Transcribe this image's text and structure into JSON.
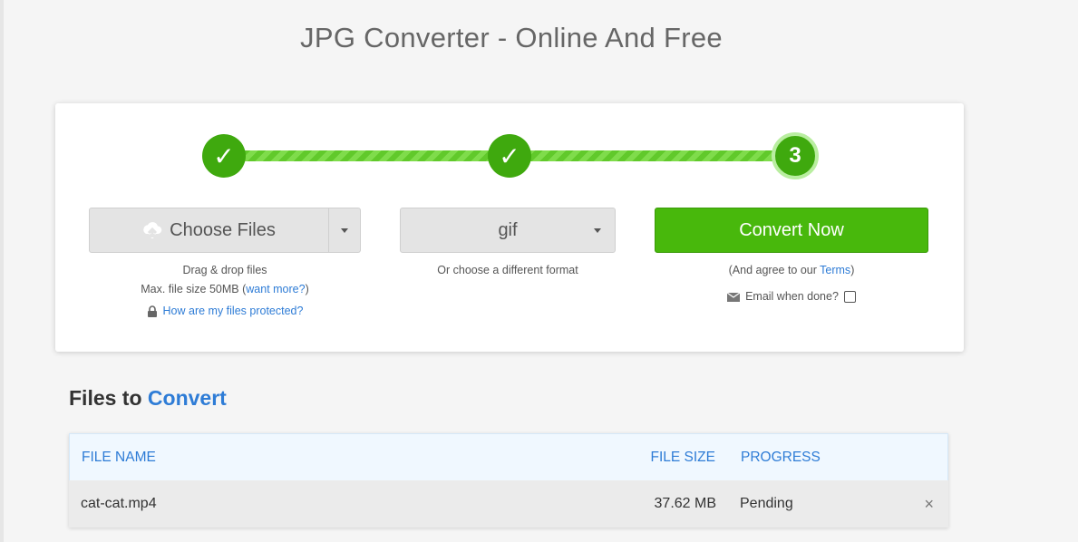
{
  "title": "JPG Converter - Online And Free",
  "steps": {
    "step1": "✓",
    "step2": "✓",
    "step3": "3"
  },
  "choose": {
    "label": "Choose Files",
    "drag": "Drag & drop files",
    "max_prefix": "Max. file size 50MB (",
    "more_link": "want more?",
    "max_suffix": ")",
    "protect_link": "How are my files protected?"
  },
  "format": {
    "value": "gif",
    "hint": "Or choose a different format"
  },
  "convert": {
    "label": "Convert Now",
    "agree_prefix": "(And agree to our ",
    "terms_link": "Terms",
    "agree_suffix": ")",
    "email_label": "Email when done?"
  },
  "files": {
    "heading_plain": "Files to",
    "heading_accent": "Convert",
    "columns": {
      "name": "FILE NAME",
      "size": "FILE SIZE",
      "progress": "PROGRESS"
    },
    "rows": [
      {
        "name": "cat-cat.mp4",
        "size": "37.62 MB",
        "progress": "Pending",
        "remove": "×"
      }
    ]
  },
  "colors": {
    "accent": "#2e7cd6",
    "green": "#48b80c",
    "step_green": "#3fa90e"
  }
}
